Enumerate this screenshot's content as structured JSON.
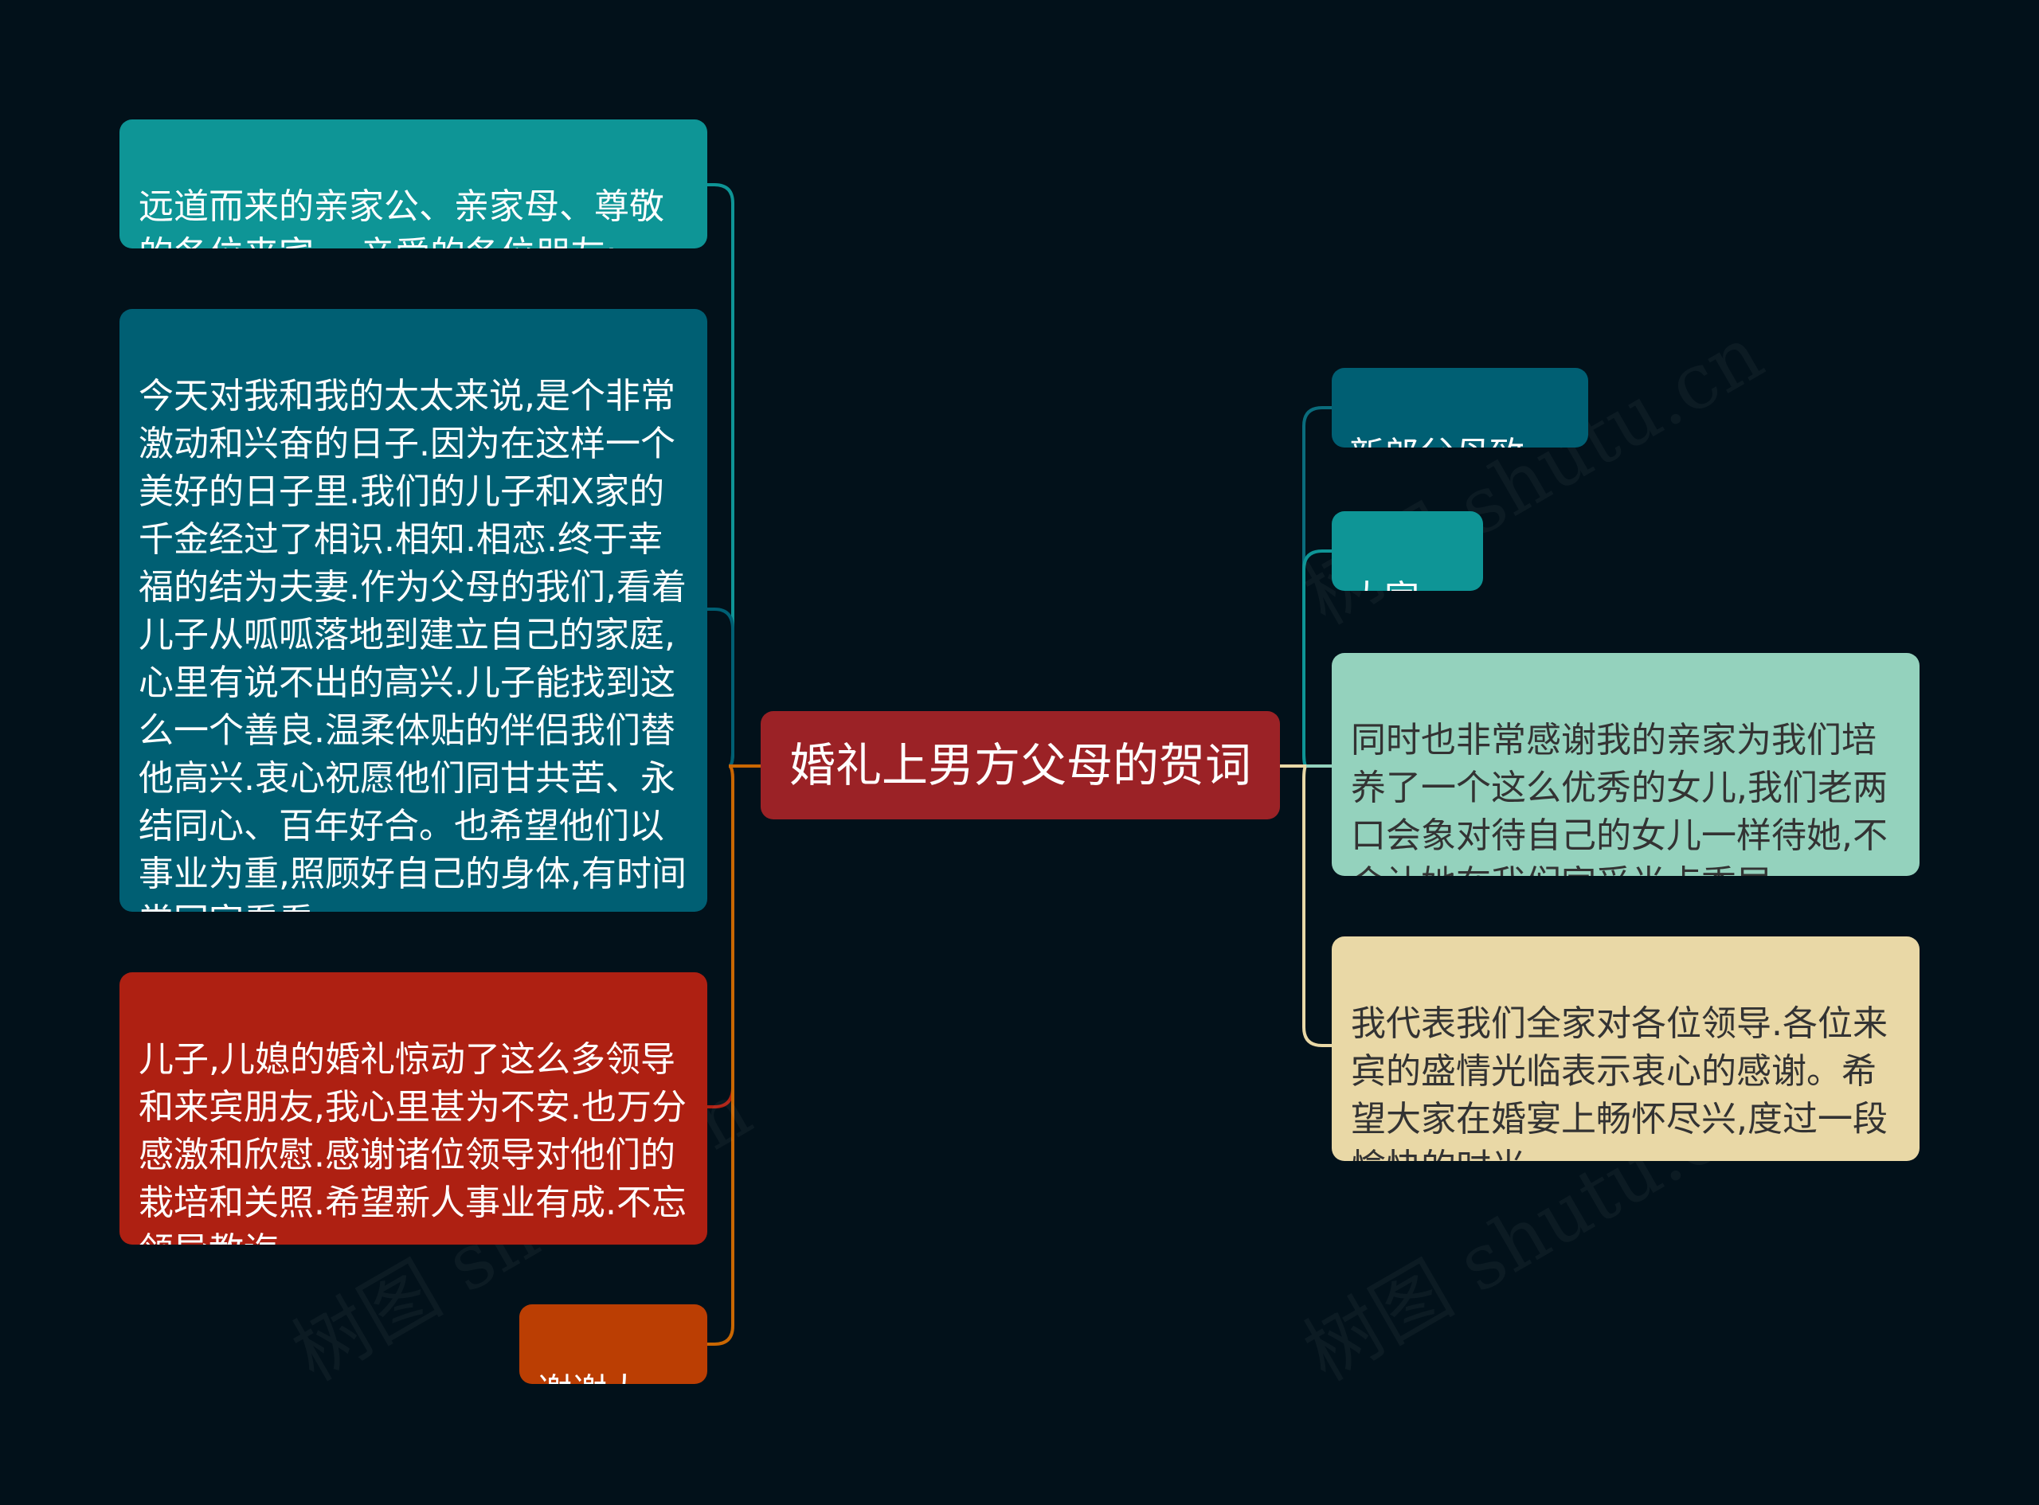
{
  "root": {
    "label": "婚礼上男方父母的贺词",
    "color": "#9b2226"
  },
  "left_branches": [
    {
      "id": "l1",
      "text": "远道而来的亲家公、亲家母、尊敬\n的各位来宾、.亲爱的各位朋友:",
      "bg": "#0e9596",
      "fg": "#ffffff",
      "line": "#0e9596"
    },
    {
      "id": "l2",
      "text": "今天对我和我的太太来说,是个非常\n激动和兴奋的日子.因为在这样一个\n美好的日子里.我们的儿子和X家的\n千金经过了相识.相知.相恋.终于幸\n福的结为夫妻.作为父母的我们,看着\n儿子从呱呱落地到建立自己的家庭,\n心里有说不出的高兴.儿子能找到这\n么一个善良.温柔体贴的伴侣我们替\n他高兴.衷心祝愿他们同甘共苦、永\n结同心、百年好合。也希望他们以\n事业为重,照顾好自己的身体,有时间\n常回家看看.",
      "bg": "#005f73",
      "fg": "#ffffff",
      "line": "#005f73"
    },
    {
      "id": "l3",
      "text": "儿子,儿媳的婚礼惊动了这么多领导\n和来宾朋友,我心里甚为不安.也万分\n感激和欣慰.感谢诸位领导对他们的\n栽培和关照.希望新人事业有成.不忘\n领导教诲。",
      "bg": "#ae2012",
      "fg": "#ffffff",
      "line": "#ae2012"
    },
    {
      "id": "l4",
      "text": "谢谢大家!",
      "bg": "#bb3e03",
      "fg": "#ffffff",
      "line": "#ca6702"
    }
  ],
  "right_branches": [
    {
      "id": "r1",
      "text": "新郎父母致辞:",
      "bg": "#005f73",
      "fg": "#ffffff",
      "line": "#0a6c7c"
    },
    {
      "id": "r2",
      "text": "大家好!",
      "bg": "#0e9596",
      "fg": "#ffffff",
      "line": "#0e9596"
    },
    {
      "id": "r3",
      "text": "同时也非常感谢我的亲家为我们培\n养了一个这么优秀的女儿,我们老两\n口会象对待自己的女儿一样待她,不\n会让她在我们家受半点委屈。",
      "bg": "#94d2bd",
      "fg": "#333333",
      "line": "#94d2bd"
    },
    {
      "id": "r4",
      "text": "我代表我们全家对各位领导.各位来\n宾的盛情光临表示衷心的感谢。希\n望大家在婚宴上畅怀尽兴,度过一段\n愉快的时光.",
      "bg": "#e9d8a6",
      "fg": "#333333",
      "line": "#e9d8a6"
    }
  ]
}
